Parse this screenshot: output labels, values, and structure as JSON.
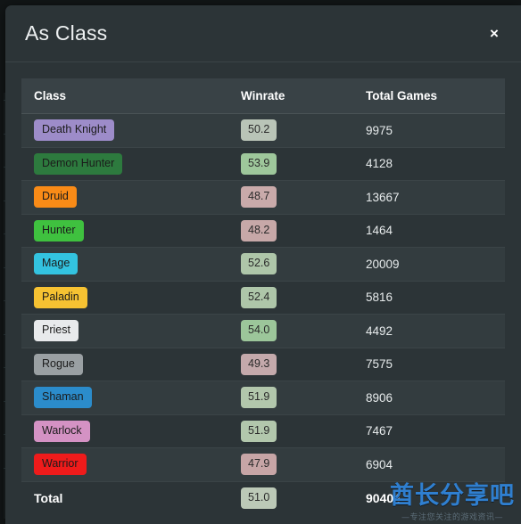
{
  "modal": {
    "title": "As Class",
    "close_label": "×",
    "close_icon": "close-icon"
  },
  "table": {
    "columns": [
      "Class",
      "Winrate",
      "Total Games"
    ],
    "rows": [
      {
        "class": "Death Knight",
        "class_color": "#9d8cc9",
        "winrate": "50.2",
        "winrate_color": "#b9c4b7",
        "games": "9975"
      },
      {
        "class": "Demon Hunter",
        "class_color": "#2d7a3e",
        "winrate": "53.9",
        "winrate_color": "#9ec79b",
        "games": "4128"
      },
      {
        "class": "Druid",
        "class_color": "#f98b17",
        "winrate": "48.7",
        "winrate_color": "#c9aaaa",
        "games": "13667"
      },
      {
        "class": "Hunter",
        "class_color": "#3fc13f",
        "winrate": "48.2",
        "winrate_color": "#c7a8a8",
        "games": "1464"
      },
      {
        "class": "Mage",
        "class_color": "#33c3e0",
        "winrate": "52.6",
        "winrate_color": "#aec6a9",
        "games": "20009"
      },
      {
        "class": "Paladin",
        "class_color": "#f6c232",
        "winrate": "52.4",
        "winrate_color": "#aec6a9",
        "games": "5816"
      },
      {
        "class": "Priest",
        "class_color": "#e8eaec",
        "winrate": "54.0",
        "winrate_color": "#9cc69a",
        "games": "4492"
      },
      {
        "class": "Rogue",
        "class_color": "#9aa0a3",
        "winrate": "49.3",
        "winrate_color": "#c4a9ab",
        "games": "7575"
      },
      {
        "class": "Shaman",
        "class_color": "#2b8ccb",
        "winrate": "51.9",
        "winrate_color": "#b2c7ac",
        "games": "8906"
      },
      {
        "class": "Warlock",
        "class_color": "#d492c4",
        "winrate": "51.9",
        "winrate_color": "#b2c7ac",
        "games": "7467"
      },
      {
        "class": "Warrior",
        "class_color": "#ef1b1b",
        "winrate": "47.9",
        "winrate_color": "#c7a5a6",
        "games": "6904"
      }
    ],
    "total": {
      "label": "Total",
      "winrate": "51.0",
      "winrate_color": "#bcc9b7",
      "games": "90404"
    }
  },
  "watermark": {
    "main": "酋长分享吧",
    "sub": "—专注您关注的游戏资讯—"
  }
}
